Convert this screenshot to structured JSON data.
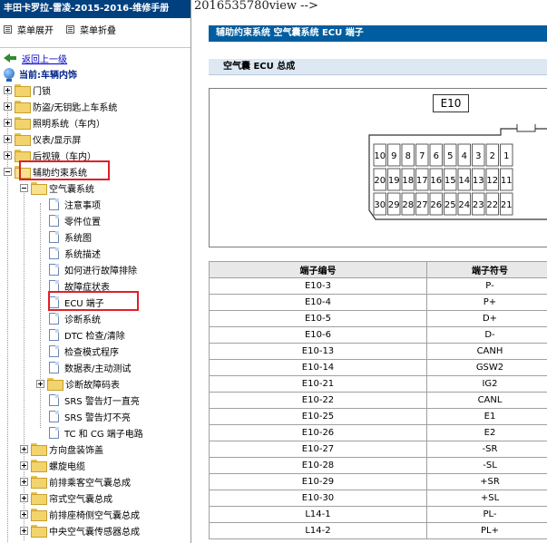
{
  "sidebar": {
    "title": "丰田卡罗拉-雷凌-2015-2016-维修手册",
    "expand_label": "菜单展开",
    "collapse_label": "菜单折叠",
    "back_label": "返回上一级",
    "current_label": "当前:车辆内饰",
    "tree": [
      {
        "label": "门锁"
      },
      {
        "label": "防盗/无钥匙上车系统"
      },
      {
        "label": "照明系统（车内）"
      },
      {
        "label": "仪表/显示屏"
      },
      {
        "label": "后视镜（车内）"
      },
      {
        "label": "辅助约束系统"
      },
      {
        "label": "空气囊系统"
      },
      {
        "label": "注意事项"
      },
      {
        "label": "零件位置"
      },
      {
        "label": "系统图"
      },
      {
        "label": "系统描述"
      },
      {
        "label": "如何进行故障排除"
      },
      {
        "label": "故障症状表"
      },
      {
        "label": "ECU 端子"
      },
      {
        "label": "诊断系统"
      },
      {
        "label": "DTC 检查/清除"
      },
      {
        "label": "检查模式程序"
      },
      {
        "label": "数据表/主动测试"
      },
      {
        "label": "诊断故障码表"
      },
      {
        "label": "SRS 警告灯一直亮"
      },
      {
        "label": "SRS 警告灯不亮"
      },
      {
        "label": "TC 和 CG 端子电路"
      },
      {
        "label": "方向盘装饰盖"
      },
      {
        "label": "螺旋电缆"
      },
      {
        "label": "前排乘客空气囊总成"
      },
      {
        "label": "帘式空气囊总成"
      },
      {
        "label": "前排座椅侧空气囊总成"
      },
      {
        "label": "中央空气囊传感器总成"
      }
    ]
  },
  "content": {
    "code_text": "2016535780view -->",
    "breadcrumb": "辅助约束系统  空气囊系统  ECU 端子",
    "section_title": "空气囊 ECU 总成",
    "connector_label": "E10",
    "pins_row1": [
      "10",
      "9",
      "8",
      "7",
      "6",
      "5",
      "4",
      "3",
      "2",
      "1"
    ],
    "pins_row2": [
      "20",
      "19",
      "18",
      "17",
      "16",
      "15",
      "14",
      "13",
      "12",
      "11"
    ],
    "pins_row3": [
      "30",
      "29",
      "28",
      "27",
      "26",
      "25",
      "24",
      "23",
      "22",
      "21"
    ],
    "table": {
      "headers": [
        "端子编号",
        "端子符号"
      ],
      "rows": [
        [
          "E10-3",
          "P-"
        ],
        [
          "E10-4",
          "P+"
        ],
        [
          "E10-5",
          "D+"
        ],
        [
          "E10-6",
          "D-"
        ],
        [
          "E10-13",
          "CANH"
        ],
        [
          "E10-14",
          "GSW2"
        ],
        [
          "E10-21",
          "IG2"
        ],
        [
          "E10-22",
          "CANL"
        ],
        [
          "E10-25",
          "E1"
        ],
        [
          "E10-26",
          "E2"
        ],
        [
          "E10-27",
          "-SR"
        ],
        [
          "E10-28",
          "-SL"
        ],
        [
          "E10-29",
          "+SR"
        ],
        [
          "E10-30",
          "+SL"
        ],
        [
          "L14-1",
          "PL-"
        ],
        [
          "L14-2",
          "PL+"
        ]
      ]
    }
  }
}
